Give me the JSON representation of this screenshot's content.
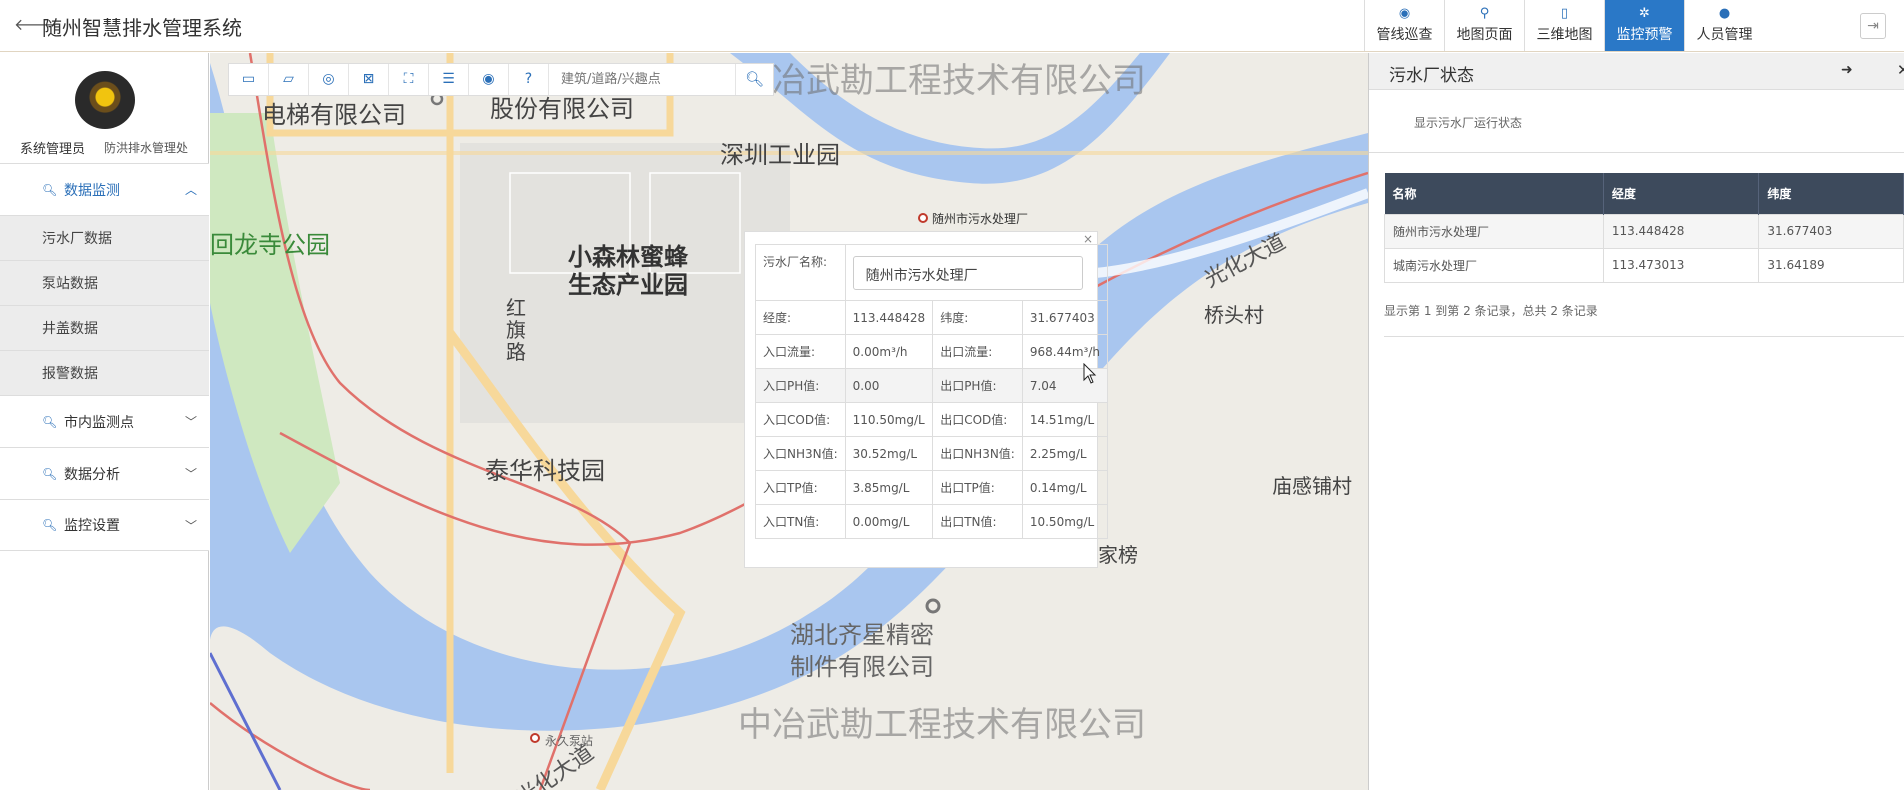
{
  "header": {
    "back_icon": "arrow-left-icon",
    "title": "随州智慧排水管理系统",
    "nav": [
      {
        "label": "管线巡查",
        "icon": "eye-icon",
        "glyph": "◉",
        "active": false
      },
      {
        "label": "地图页面",
        "icon": "map-pin-icon",
        "glyph": "⚲",
        "active": false
      },
      {
        "label": "三维地图",
        "icon": "mobile-icon",
        "glyph": "▯",
        "active": false
      },
      {
        "label": "监控预警",
        "icon": "gear-icon",
        "glyph": "✲",
        "active": true
      },
      {
        "label": "人员管理",
        "icon": "user-icon",
        "glyph": "●",
        "active": false
      }
    ],
    "logout_icon": "logout-icon"
  },
  "sidebar": {
    "user_name": "系统管理员",
    "user_dept": "防洪排水管理处",
    "menu": [
      {
        "label": "数据监测",
        "open": true,
        "items": [
          "污水厂数据",
          "泵站数据",
          "井盖数据",
          "报警数据"
        ]
      },
      {
        "label": "市内监测点",
        "open": false,
        "items": []
      },
      {
        "label": "数据分析",
        "open": false,
        "items": []
      },
      {
        "label": "监控设置",
        "open": false,
        "items": []
      }
    ]
  },
  "map": {
    "toolbar_icons": [
      "ruler-icon",
      "area-icon",
      "circle-select-icon",
      "clear-icon",
      "fullscreen-icon",
      "sliders-icon",
      "locate-icon",
      "help-icon"
    ],
    "search_placeholder": "建筑/道路/兴趣点",
    "watermark": "中冶武勘工程技术有限公司",
    "labels": {
      "elevator_co": "电梯有限公司",
      "shares_co": "股份有限公司",
      "shenzhen_park": "深圳工业园",
      "huilongsi_park": "回龙寺公园",
      "forest_park": "小森林蜜蜂\n生态产业园",
      "hongqi_road": "红\n旗\n路",
      "taihua_park": "泰华科技园",
      "guanghua_road": "光化大道",
      "qiaotou": "桥头村",
      "miaogan": "庙感铺村",
      "jiabang": "家榜",
      "hubei_qixing": "湖北齐星精密\n制件有限公司",
      "guanghua_road_2": "光化大道",
      "plant_marker": "随州市污水处理厂",
      "pump_marker": "永久泵站"
    },
    "popup": {
      "name_label": "污水厂名称:",
      "name_value": "随州市污水处理厂",
      "rows": [
        {
          "l1": "经度:",
          "v1": "113.448428",
          "l2": "纬度:",
          "v2": "31.677403"
        },
        {
          "l1": "入口流量:",
          "v1": "0.00m³/h",
          "l2": "出口流量:",
          "v2": "968.44m³/h"
        },
        {
          "l1": "入口PH值:",
          "v1": "0.00",
          "l2": "出口PH值:",
          "v2": "7.04"
        },
        {
          "l1": "入口COD值:",
          "v1": "110.50mg/L",
          "l2": "出口COD值:",
          "v2": "14.51mg/L"
        },
        {
          "l1": "入口NH3N值:",
          "v1": "30.52mg/L",
          "l2": "出口NH3N值:",
          "v2": "2.25mg/L"
        },
        {
          "l1": "入口TP值:",
          "v1": "3.85mg/L",
          "l2": "出口TP值:",
          "v2": "0.14mg/L"
        },
        {
          "l1": "入口TN值:",
          "v1": "0.00mg/L",
          "l2": "出口TN值:",
          "v2": "10.50mg/L"
        }
      ]
    }
  },
  "panel": {
    "title": "污水厂状态",
    "description": "显示污水厂运行状态",
    "columns": [
      "名称",
      "经度",
      "纬度"
    ],
    "rows": [
      [
        "随州市污水处理厂",
        "113.448428",
        "31.677403"
      ],
      [
        "城南污水处理厂",
        "113.473013",
        "31.64189"
      ]
    ],
    "footer": "显示第 1 到第 2 条记录，总共 2 条记录"
  },
  "colors": {
    "accent": "#2a78c7",
    "table_header": "#3d4a5c",
    "river": "#a9c6ef",
    "road_red": "#e0716b",
    "road_yellow": "#f7d89a"
  }
}
